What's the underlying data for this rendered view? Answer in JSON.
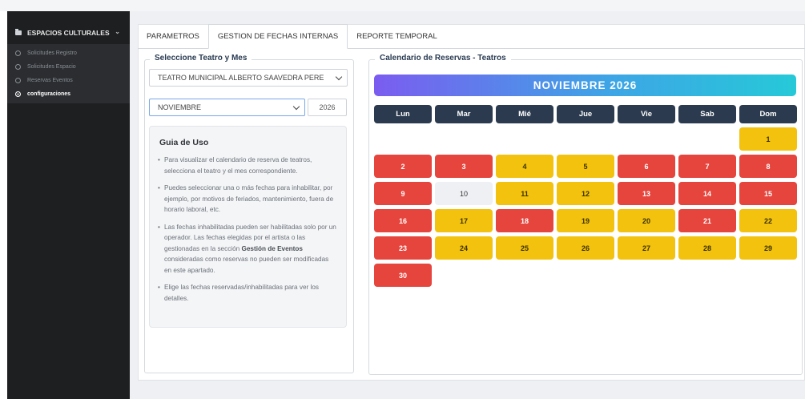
{
  "sidebar": {
    "header": "ESPACIOS CULTURALES",
    "items": [
      {
        "label": "Solicitudes Registro",
        "active": false
      },
      {
        "label": "Solicitudes Espacio",
        "active": false
      },
      {
        "label": "Reservas Eventos",
        "active": false
      },
      {
        "label": "configuraciones",
        "active": true
      }
    ]
  },
  "tabs": [
    "PARAMETROS",
    "GESTION DE FECHAS INTERNAS",
    "REPORTE TEMPORAL"
  ],
  "active_tab": "GESTION DE FECHAS INTERNAS",
  "left": {
    "legend": "Seleccione Teatro y Mes",
    "theater_value": "TEATRO MUNICIPAL ALBERTO SAAVEDRA PERE",
    "month_value": "NOVIEMBRE",
    "year_value": "2026",
    "guide": {
      "title": "Guia de Uso",
      "items": [
        "Para visualizar el calendario de reserva de teatros, selecciona el teatro y el mes correspondiente.",
        "Puedes seleccionar una o más fechas para inhabilitar, por ejemplo, por motivos de feriados, mantenimiento, fuera de horario laboral, etc.",
        "Las fechas inhabilitadas pueden ser habilitadas solo por un operador. Las fechas elegidas por el artista o las gestionadas en la sección Gestión de Eventos consideradas como reservas no pueden ser modificadas en este apartado.",
        "Elige las fechas reservadas/inhabilitadas para ver los detalles."
      ]
    }
  },
  "calendar": {
    "legend": "Calendario de Reservas - Teatros",
    "title": "NOVIEMBRE 2026",
    "weekdays": [
      "Lun",
      "Mar",
      "Mié",
      "Jue",
      "Vie",
      "Sab",
      "Dom"
    ],
    "colors": {
      "red": "#e5453d",
      "yellow": "#f2c20e",
      "free": "#eef0f3",
      "header": "#2b3a4e"
    },
    "first_weekday_index": 6,
    "days": [
      {
        "day": "1",
        "status": "yellow"
      },
      {
        "day": "2",
        "status": "red"
      },
      {
        "day": "3",
        "status": "red"
      },
      {
        "day": "4",
        "status": "yellow"
      },
      {
        "day": "5",
        "status": "yellow"
      },
      {
        "day": "6",
        "status": "red"
      },
      {
        "day": "7",
        "status": "red"
      },
      {
        "day": "8",
        "status": "red"
      },
      {
        "day": "9",
        "status": "red"
      },
      {
        "day": "10",
        "status": "free"
      },
      {
        "day": "11",
        "status": "yellow"
      },
      {
        "day": "12",
        "status": "yellow"
      },
      {
        "day": "13",
        "status": "red"
      },
      {
        "day": "14",
        "status": "red"
      },
      {
        "day": "15",
        "status": "red"
      },
      {
        "day": "16",
        "status": "red"
      },
      {
        "day": "17",
        "status": "yellow"
      },
      {
        "day": "18",
        "status": "red"
      },
      {
        "day": "19",
        "status": "yellow"
      },
      {
        "day": "20",
        "status": "yellow"
      },
      {
        "day": "21",
        "status": "red"
      },
      {
        "day": "22",
        "status": "yellow"
      },
      {
        "day": "23",
        "status": "red"
      },
      {
        "day": "24",
        "status": "yellow"
      },
      {
        "day": "25",
        "status": "yellow"
      },
      {
        "day": "26",
        "status": "yellow"
      },
      {
        "day": "27",
        "status": "yellow"
      },
      {
        "day": "28",
        "status": "yellow"
      },
      {
        "day": "29",
        "status": "yellow"
      },
      {
        "day": "30",
        "status": "red"
      }
    ]
  }
}
